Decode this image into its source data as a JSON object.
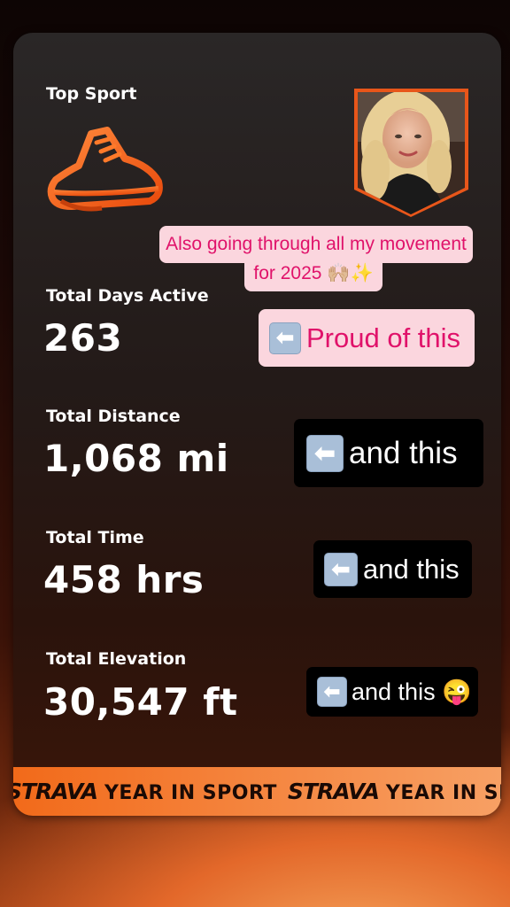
{
  "stats": {
    "top_sport_label": "Top Sport",
    "top_sport_icon": "shoe-icon",
    "days_label": "Total Days Active",
    "days_value": "263",
    "distance_label": "Total Distance",
    "distance_value": "1,068 mi",
    "time_label": "Total Time",
    "time_value": "458 hrs",
    "elevation_label": "Total Elevation",
    "elevation_value": "30,547 ft"
  },
  "stickers": {
    "caption_line1": "Also going through all my movement",
    "caption_line2": "for 2025 🙌🏼✨",
    "proud": "Proud of this",
    "and_this_1": "and this",
    "and_this_2": "and this",
    "and_this_3": "and this 😜",
    "arrow_icon": "left-arrow-emoji-icon"
  },
  "banner": {
    "brand": "STRAVA",
    "tagline": "YEAR IN SPORT"
  },
  "colors": {
    "accent_orange": "#f26a1a",
    "sticker_pink_bg": "#fbd6de",
    "sticker_pink_text": "#e0126a"
  }
}
